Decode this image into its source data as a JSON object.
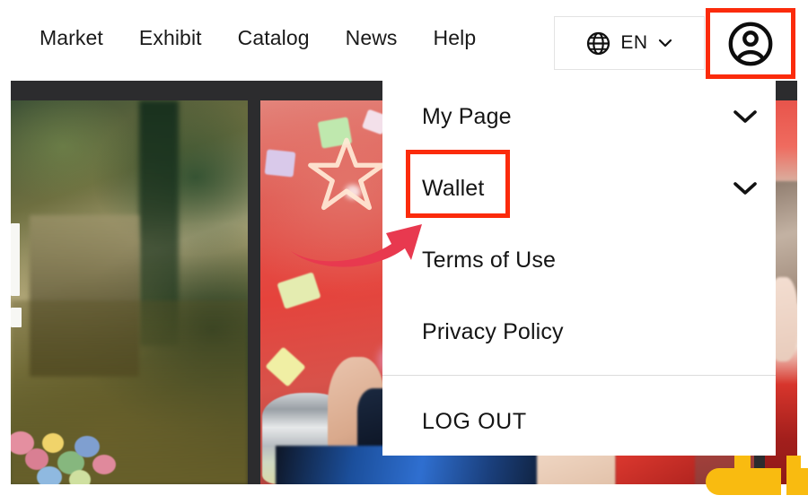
{
  "nav": {
    "links": [
      {
        "label": "Market"
      },
      {
        "label": "Exhibit"
      },
      {
        "label": "Catalog"
      },
      {
        "label": "News"
      },
      {
        "label": "Help"
      }
    ],
    "language": {
      "icon": "globe-icon",
      "value": "EN",
      "caret_icon": "chevron-down-icon"
    },
    "account": {
      "icon": "account-circle-icon",
      "highlighted": true,
      "highlight_color": "#fb2b0b"
    }
  },
  "dropdown": {
    "items": [
      {
        "label": "My Page",
        "has_chevron": true,
        "chevron_icon": "chevron-down-icon",
        "highlighted": false
      },
      {
        "label": "Wallet",
        "has_chevron": true,
        "chevron_icon": "chevron-down-icon",
        "highlighted": true
      },
      {
        "label": "Terms of Use",
        "has_chevron": false,
        "chevron_icon": "",
        "highlighted": false
      },
      {
        "label": "Privacy Policy",
        "has_chevron": false,
        "chevron_icon": "",
        "highlighted": false
      },
      {
        "label": "LOG OUT",
        "has_chevron": false,
        "chevron_icon": "",
        "highlighted": false
      }
    ],
    "divider_after_index": 3,
    "background": "#ffffff"
  },
  "annotations": {
    "arrow": {
      "icon": "curved-arrow-icon",
      "color": "#e8394f",
      "points_to": "Wallet"
    },
    "highlight_boxes": [
      {
        "target": "account-circle-icon",
        "color": "#fb2b0b"
      },
      {
        "target": "Wallet",
        "color": "#fb2b0b"
      }
    ]
  },
  "hero": {
    "frame_color": "#2c2c2e",
    "cards": [
      {
        "name": "artwork-card-left",
        "description": "dark green and olive painted cityscape with flowers"
      },
      {
        "name": "artwork-card-center",
        "description": "red neon photo with star outline, confetti and performer holding a glass"
      },
      {
        "name": "artwork-card-right",
        "description": "performer with light hair in red outfit"
      }
    ],
    "logo_mark": {
      "name": "yellow-logo-mark",
      "color": "#f9bb10"
    }
  }
}
